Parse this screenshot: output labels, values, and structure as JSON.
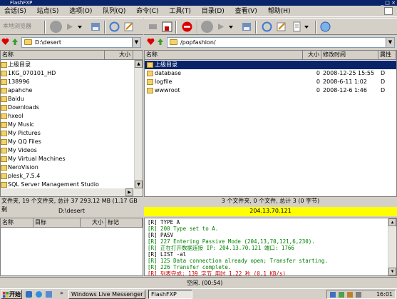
{
  "window": {
    "title": "FlashFXP"
  },
  "menu": [
    "会话(S)",
    "站点(S)",
    "选项(O)",
    "队列(Q)",
    "命令(C)",
    "工具(T)",
    "目录(D)",
    "查看(V)",
    "帮助(H)"
  ],
  "left_toolbar": {
    "label": "本地浏览器"
  },
  "left_path": "D:\\desert",
  "right_path": "/popfashion/",
  "left_headers": {
    "name": "名称",
    "size": "大小"
  },
  "right_headers": {
    "name": "名称",
    "size": "大小",
    "modified": "修改时间",
    "attr": "属性"
  },
  "left_files": [
    {
      "name": "上级目录",
      "icon": "up-folder-icon"
    },
    {
      "name": "1KG_070101_HD",
      "icon": "folder-icon"
    },
    {
      "name": "138996",
      "icon": "folder-icon"
    },
    {
      "name": "apahche",
      "icon": "folder-icon"
    },
    {
      "name": "Baidu",
      "icon": "folder-icon"
    },
    {
      "name": "Downloads",
      "icon": "folder-icon"
    },
    {
      "name": "hxeol",
      "icon": "folder-icon"
    },
    {
      "name": "My Music",
      "icon": "folder-icon"
    },
    {
      "name": "My Pictures",
      "icon": "folder-icon"
    },
    {
      "name": "My QQ Files",
      "icon": "folder-icon"
    },
    {
      "name": "My Videos",
      "icon": "folder-icon"
    },
    {
      "name": "My Virtual Machines",
      "icon": "folder-icon"
    },
    {
      "name": "NeroVision",
      "icon": "folder-icon"
    },
    {
      "name": "plesk_7.5.4",
      "icon": "folder-icon"
    },
    {
      "name": "SQL Server Management Studio",
      "icon": "folder-icon"
    }
  ],
  "right_files": [
    {
      "name": "上级目录",
      "size": "",
      "modified": "",
      "attr": "",
      "selected": true
    },
    {
      "name": "database",
      "size": "0",
      "modified": "2008-12-25 15:55",
      "attr": "D"
    },
    {
      "name": "logfile",
      "size": "0",
      "modified": "2008-6-11 1:02",
      "attr": "D"
    },
    {
      "name": "wwwroot",
      "size": "0",
      "modified": "2008-12-6 1:46",
      "attr": "D"
    }
  ],
  "left_status": "文件夹, 19 个文件夹, 总计 37 293.12 MB (1.17 GB 剩",
  "right_status": "3 个文件夹, 0 个文件, 总计 3 (0 字节)",
  "left_path_status": "D:\\desert",
  "right_host": "204.13.70.121",
  "queue_headers": {
    "name": "名称",
    "target": "目标",
    "size": "大小",
    "flag": "标记"
  },
  "log_lines": [
    {
      "text": "[R] TYPE A",
      "color": "#000000"
    },
    {
      "text": "[R] 200 Type set to A.",
      "color": "#008000"
    },
    {
      "text": "[R] PASV",
      "color": "#000000"
    },
    {
      "text": "[R] 227 Entering Passive Mode (204,13,70,121,6,230).",
      "color": "#008000"
    },
    {
      "text": "[R] 正在打开数据连接 IP: 204.13.70.121 端口: 1766",
      "color": "#008000"
    },
    {
      "text": "[R] LIST -al",
      "color": "#000000"
    },
    {
      "text": "[R] 125 Data connection already open; Transfer starting.",
      "color": "#008000"
    },
    {
      "text": "[R] 226 Transfer complete.",
      "color": "#008000"
    },
    {
      "text": "[R] 列表完成: 139 字节 用时 1.22 秒 (0.1 KB/s)",
      "color": "#cc0000"
    }
  ],
  "idle_status": "空闲. (00:54)",
  "taskbar": {
    "start": "开始",
    "tasks": [
      "Windows Live Messenger",
      "FlashFXP"
    ],
    "clock": "16:01"
  }
}
